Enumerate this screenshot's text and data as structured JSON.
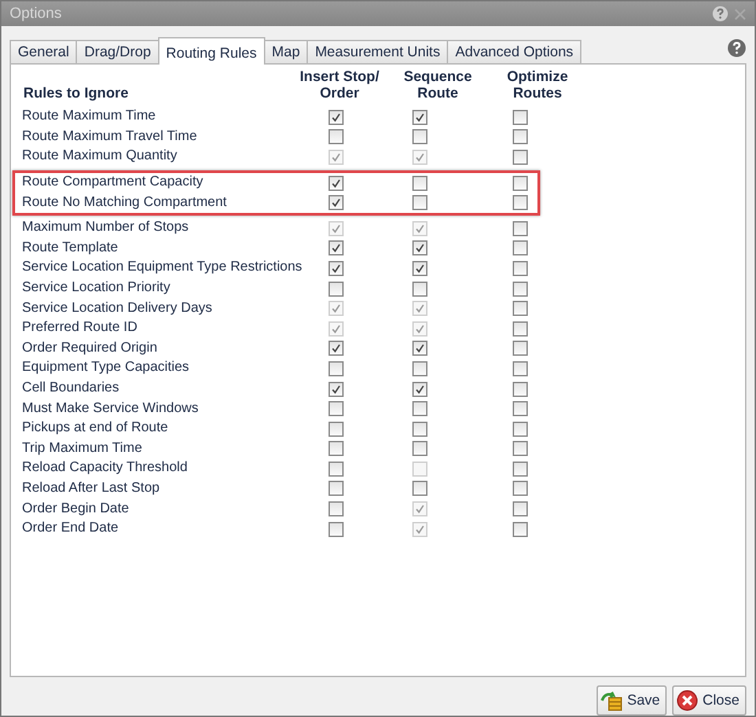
{
  "window": {
    "title": "Options"
  },
  "tabs": [
    {
      "label": "General",
      "selected": false
    },
    {
      "label": "Drag/Drop",
      "selected": false
    },
    {
      "label": "Routing Rules",
      "selected": true
    },
    {
      "label": "Map",
      "selected": false
    },
    {
      "label": "Measurement Units",
      "selected": false
    },
    {
      "label": "Advanced Options",
      "selected": false
    }
  ],
  "table": {
    "columns": [
      "Rules to Ignore",
      "Insert Stop/ Order",
      "Sequence Route",
      "Optimize Routes"
    ],
    "rows": [
      {
        "label": "Route Maximum Time",
        "highlighted": false,
        "cells": [
          {
            "checked": true,
            "disabled": false
          },
          {
            "checked": true,
            "disabled": false
          },
          {
            "checked": false,
            "disabled": false
          }
        ]
      },
      {
        "label": "Route Maximum Travel Time",
        "highlighted": false,
        "cells": [
          {
            "checked": false,
            "disabled": false
          },
          {
            "checked": false,
            "disabled": false
          },
          {
            "checked": false,
            "disabled": false
          }
        ]
      },
      {
        "label": "Route Maximum Quantity",
        "highlighted": false,
        "cells": [
          {
            "checked": true,
            "disabled": true
          },
          {
            "checked": true,
            "disabled": true
          },
          {
            "checked": false,
            "disabled": false
          }
        ]
      },
      {
        "label": "Route Compartment Capacity",
        "highlighted": true,
        "cells": [
          {
            "checked": true,
            "disabled": false
          },
          {
            "checked": false,
            "disabled": false
          },
          {
            "checked": false,
            "disabled": false
          }
        ]
      },
      {
        "label": "Route No Matching Compartment",
        "highlighted": true,
        "cells": [
          {
            "checked": true,
            "disabled": false
          },
          {
            "checked": false,
            "disabled": false
          },
          {
            "checked": false,
            "disabled": false
          }
        ]
      },
      {
        "label": "Maximum Number of Stops",
        "highlighted": false,
        "cells": [
          {
            "checked": true,
            "disabled": true
          },
          {
            "checked": true,
            "disabled": true
          },
          {
            "checked": false,
            "disabled": false
          }
        ]
      },
      {
        "label": "Route Template",
        "highlighted": false,
        "cells": [
          {
            "checked": true,
            "disabled": false
          },
          {
            "checked": true,
            "disabled": false
          },
          {
            "checked": false,
            "disabled": false
          }
        ]
      },
      {
        "label": "Service Location Equipment Type Restrictions",
        "highlighted": false,
        "cells": [
          {
            "checked": true,
            "disabled": false
          },
          {
            "checked": true,
            "disabled": false
          },
          {
            "checked": false,
            "disabled": false
          }
        ]
      },
      {
        "label": "Service Location Priority",
        "highlighted": false,
        "cells": [
          {
            "checked": false,
            "disabled": false
          },
          {
            "checked": false,
            "disabled": false
          },
          {
            "checked": false,
            "disabled": false
          }
        ]
      },
      {
        "label": "Service Location Delivery Days",
        "highlighted": false,
        "cells": [
          {
            "checked": true,
            "disabled": true
          },
          {
            "checked": true,
            "disabled": true
          },
          {
            "checked": false,
            "disabled": false
          }
        ]
      },
      {
        "label": "Preferred Route ID",
        "highlighted": false,
        "cells": [
          {
            "checked": true,
            "disabled": true
          },
          {
            "checked": true,
            "disabled": true
          },
          {
            "checked": false,
            "disabled": false
          }
        ]
      },
      {
        "label": "Order Required Origin",
        "highlighted": false,
        "cells": [
          {
            "checked": true,
            "disabled": false
          },
          {
            "checked": true,
            "disabled": false
          },
          {
            "checked": false,
            "disabled": false
          }
        ]
      },
      {
        "label": "Equipment Type Capacities",
        "highlighted": false,
        "cells": [
          {
            "checked": false,
            "disabled": false
          },
          {
            "checked": false,
            "disabled": false
          },
          {
            "checked": false,
            "disabled": false
          }
        ]
      },
      {
        "label": "Cell Boundaries",
        "highlighted": false,
        "cells": [
          {
            "checked": true,
            "disabled": false
          },
          {
            "checked": true,
            "disabled": false
          },
          {
            "checked": false,
            "disabled": false
          }
        ]
      },
      {
        "label": "Must Make Service Windows",
        "highlighted": false,
        "cells": [
          {
            "checked": false,
            "disabled": false
          },
          {
            "checked": false,
            "disabled": false
          },
          {
            "checked": false,
            "disabled": false
          }
        ]
      },
      {
        "label": "Pickups at end of Route",
        "highlighted": false,
        "cells": [
          {
            "checked": false,
            "disabled": false
          },
          {
            "checked": false,
            "disabled": false
          },
          {
            "checked": false,
            "disabled": false
          }
        ]
      },
      {
        "label": "Trip Maximum Time",
        "highlighted": false,
        "cells": [
          {
            "checked": false,
            "disabled": false
          },
          {
            "checked": false,
            "disabled": false
          },
          {
            "checked": false,
            "disabled": false
          }
        ]
      },
      {
        "label": "Reload Capacity Threshold",
        "highlighted": false,
        "cells": [
          {
            "checked": false,
            "disabled": false
          },
          {
            "checked": false,
            "disabled": true
          },
          {
            "checked": false,
            "disabled": false
          }
        ]
      },
      {
        "label": "Reload After Last Stop",
        "highlighted": false,
        "cells": [
          {
            "checked": false,
            "disabled": false
          },
          {
            "checked": false,
            "disabled": false
          },
          {
            "checked": false,
            "disabled": false
          }
        ]
      },
      {
        "label": "Order Begin Date",
        "highlighted": false,
        "cells": [
          {
            "checked": false,
            "disabled": false
          },
          {
            "checked": true,
            "disabled": true
          },
          {
            "checked": false,
            "disabled": false
          }
        ]
      },
      {
        "label": "Order End Date",
        "highlighted": false,
        "cells": [
          {
            "checked": false,
            "disabled": false
          },
          {
            "checked": true,
            "disabled": true
          },
          {
            "checked": false,
            "disabled": false
          }
        ]
      }
    ]
  },
  "buttons": [
    {
      "label": "Save",
      "kind": "save"
    },
    {
      "label": "Close",
      "kind": "close"
    }
  ]
}
